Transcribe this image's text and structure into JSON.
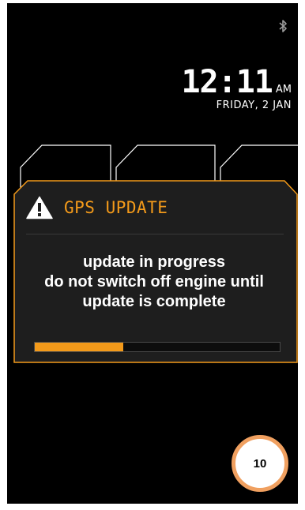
{
  "status_bar": {
    "icon": "bluetooth-icon"
  },
  "clock": {
    "time": "12:11",
    "ampm": "AM",
    "date": "FRIDAY, 2 JAN"
  },
  "dialog": {
    "icon": "warning-icon",
    "title": "GPS UPDATE",
    "message_lines": [
      "update in progress",
      "do not switch off engine until",
      "update is complete"
    ],
    "progress": 0.36
  },
  "annotation": {
    "label": "10"
  },
  "colors": {
    "accent": "#f39a1a",
    "screen_bg": "#000000",
    "dialog_bg": "#1e1e1e",
    "badge_border": "#f0a060"
  }
}
